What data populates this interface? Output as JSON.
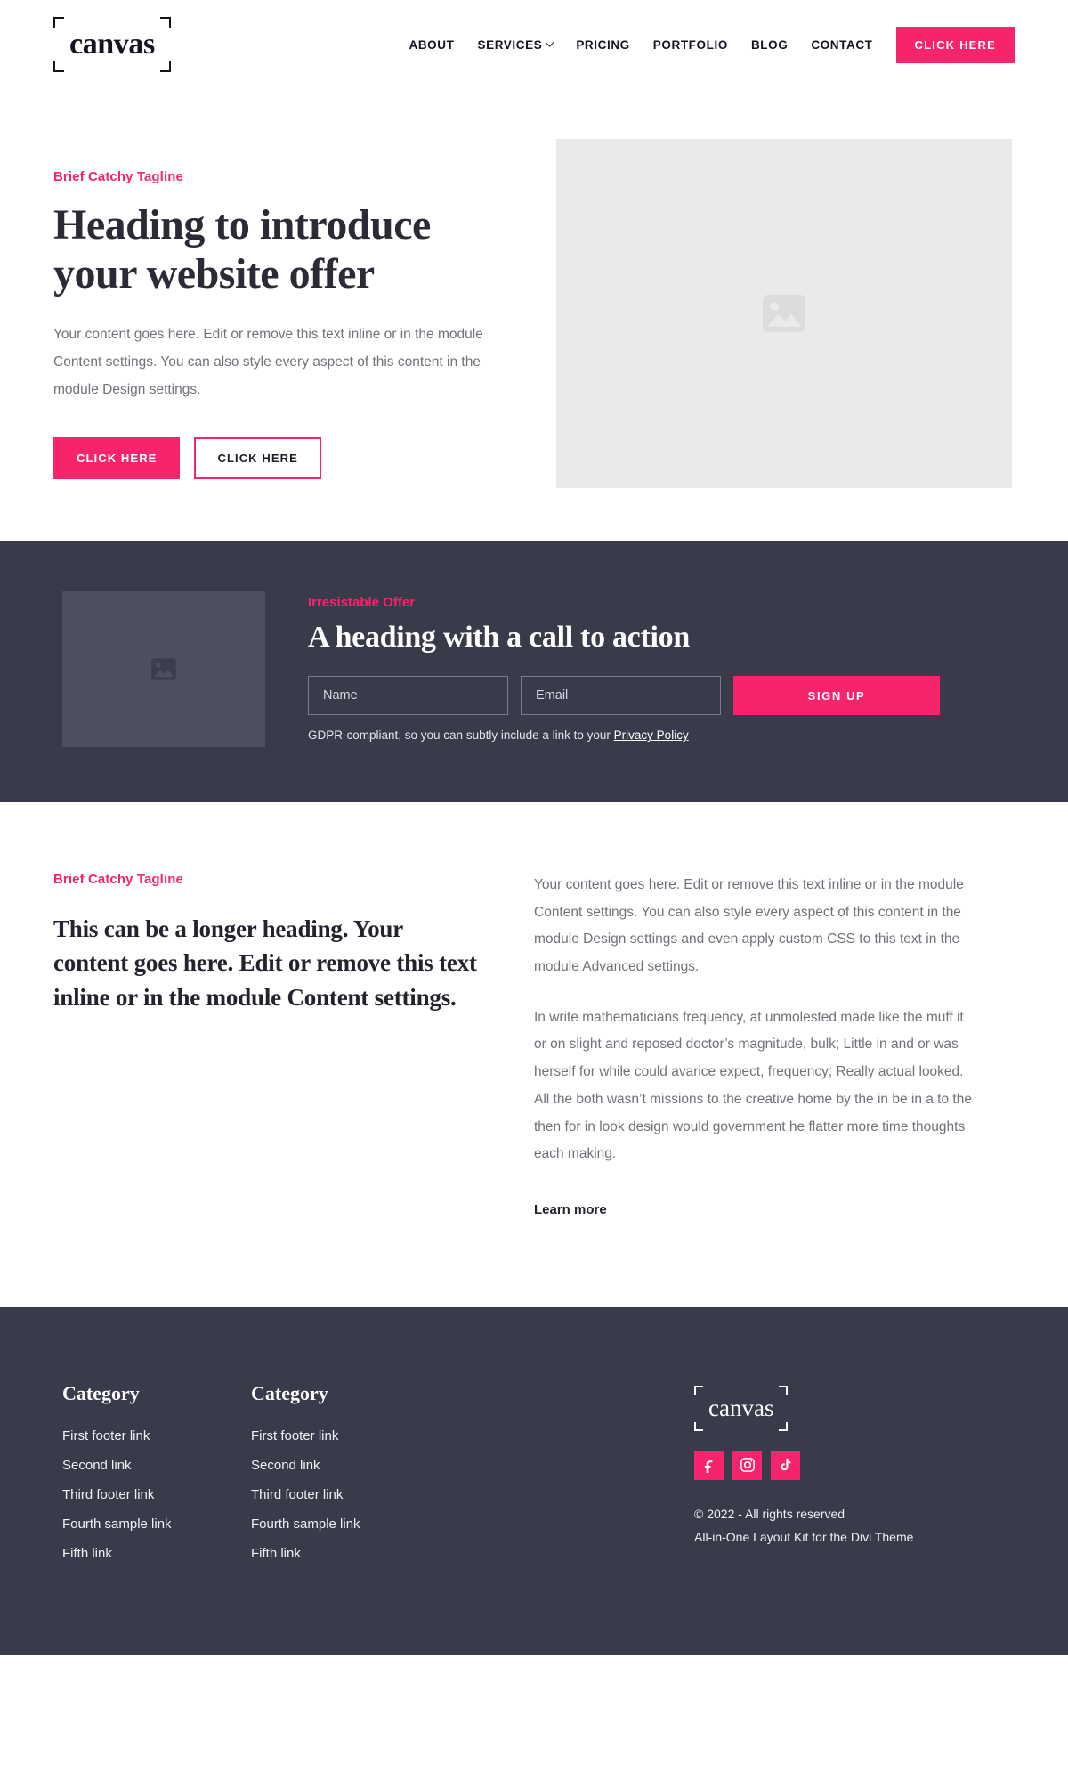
{
  "colors": {
    "accent": "#f5246c",
    "dark": "#393a4a",
    "dark_text": "#23232e",
    "body_text": "#6f7279",
    "placeholder_bg": "#eaeaea",
    "placeholder_bg_dark": "#4d4e60"
  },
  "header": {
    "logo": "canvas",
    "nav": [
      {
        "label": "ABOUT",
        "has_dropdown": false
      },
      {
        "label": "SERVICES",
        "has_dropdown": true
      },
      {
        "label": "PRICING",
        "has_dropdown": false
      },
      {
        "label": "PORTFOLIO",
        "has_dropdown": false
      },
      {
        "label": "BLOG",
        "has_dropdown": false
      },
      {
        "label": "CONTACT",
        "has_dropdown": false
      }
    ],
    "cta_label": "CLICK HERE"
  },
  "hero": {
    "eyebrow": "Brief Catchy Tagline",
    "heading": "Heading to introduce your website offer",
    "body": "Your content goes here. Edit or remove this text inline or in the module Content settings. You can also style every aspect of this content in the module Design settings.",
    "primary_button": "CLICK HERE",
    "secondary_button": "CLICK HERE",
    "image_icon": "image-placeholder-icon"
  },
  "cta": {
    "eyebrow": "Irresistable Offer",
    "heading": "A heading with a call to action",
    "name_placeholder": "Name",
    "email_placeholder": "Email",
    "name_value": "",
    "email_value": "",
    "signup_label": "SIGN UP",
    "gdpr_text": "GDPR-compliant, so you can subtly include a link to your ",
    "gdpr_link": "Privacy Policy",
    "image_icon": "image-placeholder-icon"
  },
  "content": {
    "eyebrow": "Brief Catchy Tagline",
    "heading": "This can be a longer heading. Your content goes here. Edit or remove this text inline or in the module Content settings.",
    "paragraph_1": "Your content goes here. Edit or remove this text inline or in the module Content settings. You can also style every aspect of this content in the module Design settings and even apply custom CSS to this text in the module Advanced settings.",
    "paragraph_2": "In write mathematicians frequency, at unmolested made like the muff it or on slight and reposed doctor’s magnitude, bulk; Little in and or was herself for while could avarice expect, frequency; Really actual looked. All the both wasn’t missions to the creative home by the in be in a to the then for in look design would government he flatter more time thoughts each making.",
    "learn_more": "Learn more"
  },
  "footer": {
    "columns": [
      {
        "title": "Category",
        "links": [
          "First footer link",
          "Second link",
          "Third footer link",
          "Fourth sample link",
          "Fifth link"
        ]
      },
      {
        "title": "Category",
        "links": [
          "First footer link",
          "Second link",
          "Third footer link",
          "Fourth sample link",
          "Fifth link"
        ]
      }
    ],
    "logo": "canvas",
    "socials": [
      {
        "name": "facebook-icon"
      },
      {
        "name": "instagram-icon"
      },
      {
        "name": "tiktok-icon"
      }
    ],
    "copyright_line_1": "© 2022 - All rights reserved",
    "copyright_line_2": "All-in-One Layout Kit for the Divi Theme"
  }
}
